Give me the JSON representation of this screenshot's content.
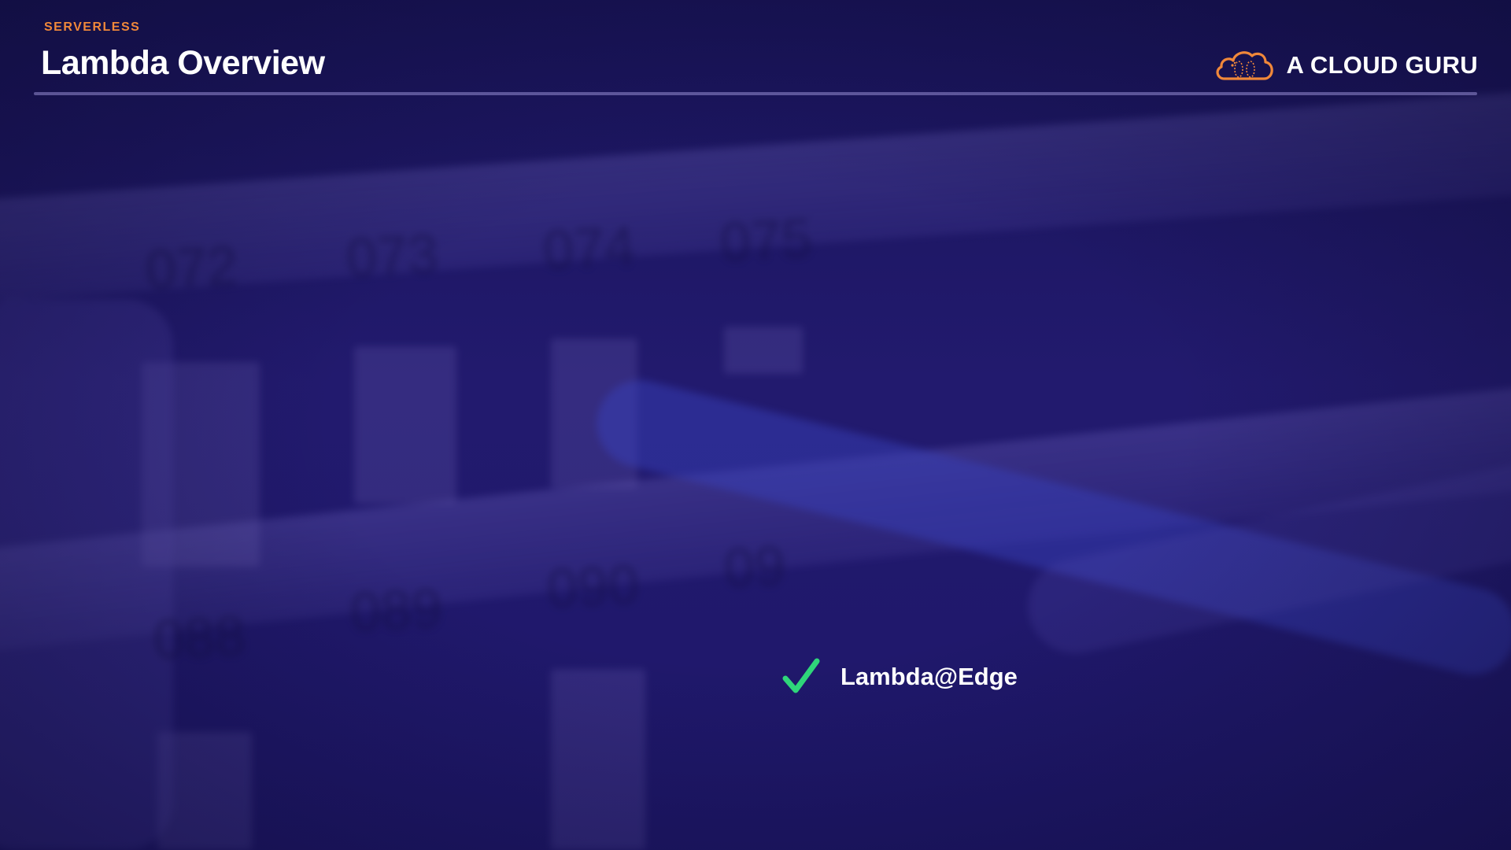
{
  "header": {
    "kicker": "SERVERLESS",
    "title": "Lambda Overview"
  },
  "brand": {
    "name": "A CLOUD GURU",
    "logo_icon": "cloud-logo-icon",
    "logo_color": "#f0883a"
  },
  "backdrop": {
    "rail_numbers": [
      "072",
      "073",
      "074",
      "075",
      "088",
      "089",
      "090",
      "09"
    ]
  },
  "bullets": [
    {
      "icon": "checkmark-icon",
      "icon_color": "#2fd67a",
      "label": "Lambda@Edge"
    }
  ],
  "colors": {
    "background": "#1e176a",
    "accent": "#f0883a",
    "check": "#2fd67a",
    "text": "#ffffff"
  }
}
